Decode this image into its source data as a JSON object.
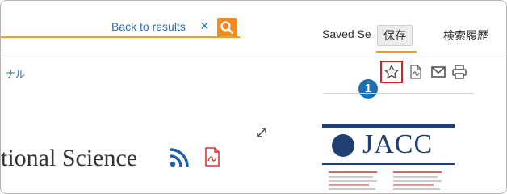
{
  "topbar": {
    "back_label": "Back to results",
    "close_symbol": "×",
    "search_icon": "search-icon",
    "saved_searches_label": "Saved Se",
    "tooltip_label": "保存",
    "history_label": "検索履歴",
    "accent_color": "#f08a24"
  },
  "toolbar": {
    "journal_label": "ナル",
    "icons": [
      "star-icon",
      "pdf-icon",
      "mail-icon",
      "print-icon"
    ],
    "highlight_color": "#d0232a"
  },
  "callout": {
    "number": "1"
  },
  "article": {
    "title_fragment": "tional Science",
    "icons": [
      "rss-icon",
      "pdf-icon",
      "expand-icon"
    ]
  },
  "cover": {
    "journal_name": "JACC"
  }
}
